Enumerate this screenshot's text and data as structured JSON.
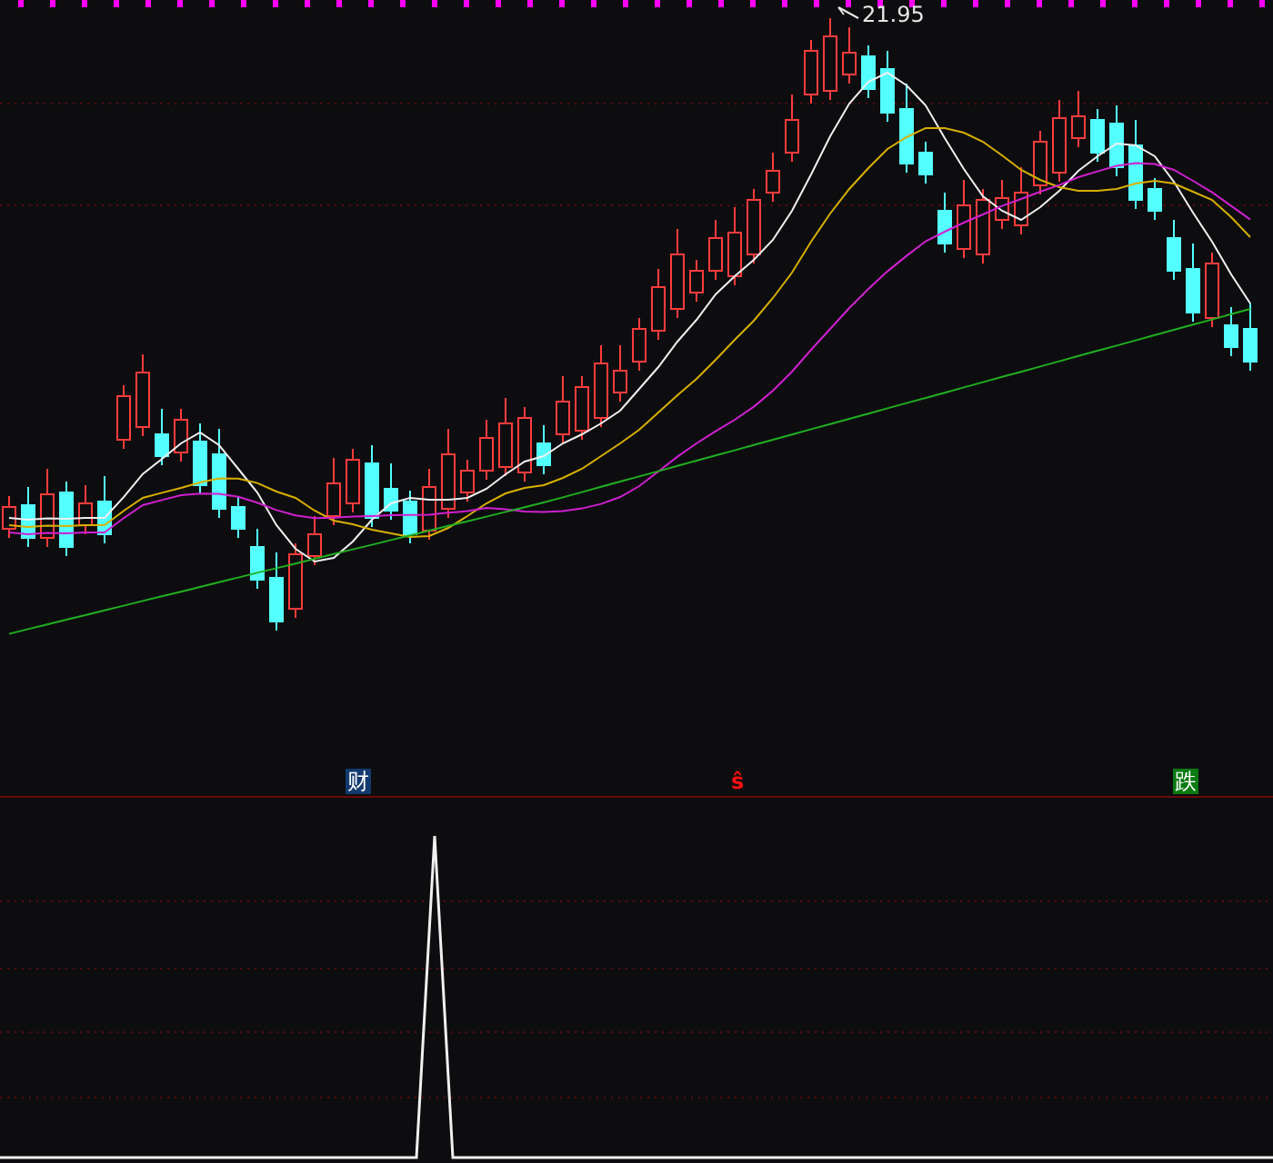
{
  "main_chart": {
    "high_label": "21.95"
  },
  "signals": [
    {
      "kind": "badge",
      "text": "财",
      "color": "#123a6e"
    },
    {
      "kind": "glyph",
      "text": "ŝ",
      "color": "#ff1010"
    },
    {
      "kind": "badge",
      "text": "跌",
      "color": "#0b7a12"
    }
  ]
}
